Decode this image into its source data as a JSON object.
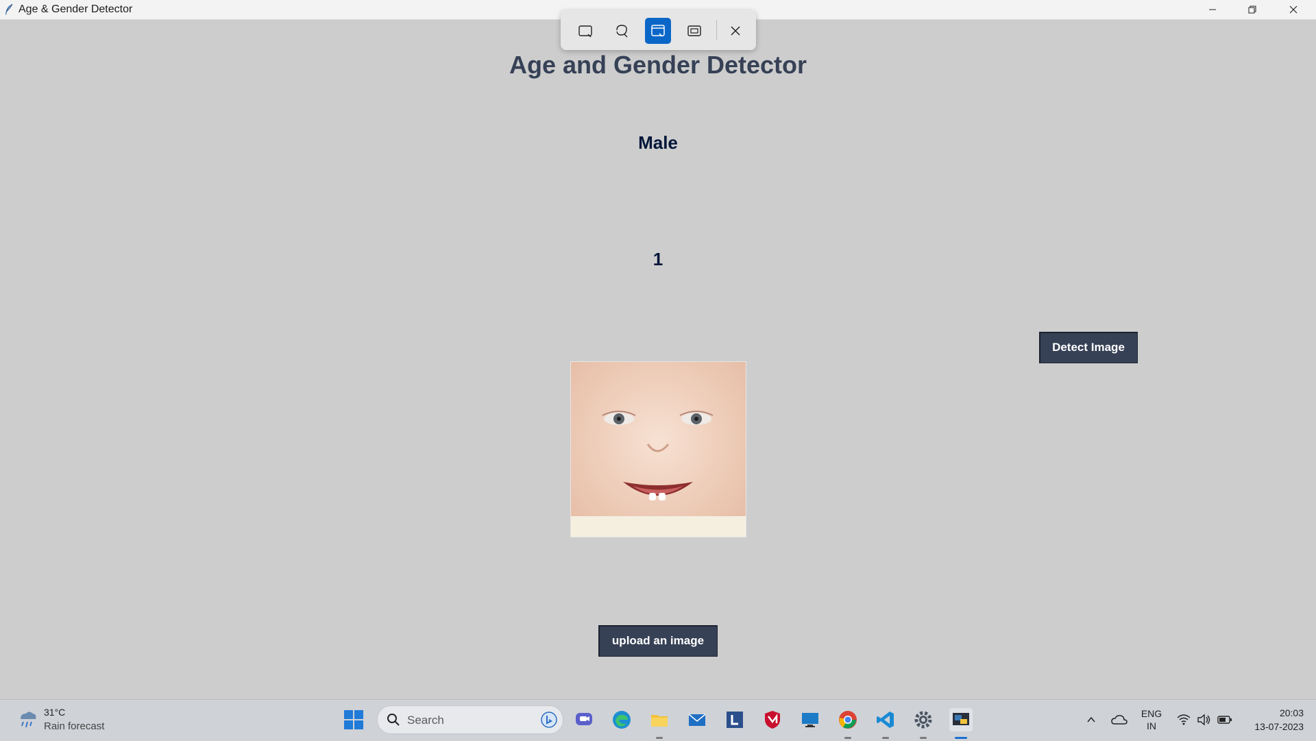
{
  "window": {
    "title": "Age & Gender Detector"
  },
  "app": {
    "heading": "Age and Gender Detector",
    "gender_result": "Male",
    "age_result": "1",
    "detect_button": "Detect Image",
    "upload_button": "upload an image",
    "image_alt": "baby face photo"
  },
  "snip_toolbar": {
    "modes": [
      "rectangle-snip",
      "freeform-snip",
      "window-snip",
      "fullscreen-snip"
    ],
    "active_mode": "window-snip"
  },
  "taskbar": {
    "weather_temp": "31°C",
    "weather_desc": "Rain forecast",
    "search_placeholder": "Search",
    "apps": [
      "windows-start",
      "search",
      "bing-chat",
      "teams-chat",
      "edge",
      "file-explorer",
      "mail",
      "app-l",
      "mcafee",
      "remote-desktop",
      "chrome",
      "vscode",
      "settings",
      "python-app"
    ],
    "language_line1": "ENG",
    "language_line2": "IN",
    "time": "20:03",
    "date": "13-07-2023"
  },
  "colors": {
    "background": "#cdcdcd",
    "heading": "#364156",
    "result_text": "#011638",
    "button_bg": "#364156",
    "button_text": "#ffffff",
    "snip_active": "#0a67c7"
  }
}
